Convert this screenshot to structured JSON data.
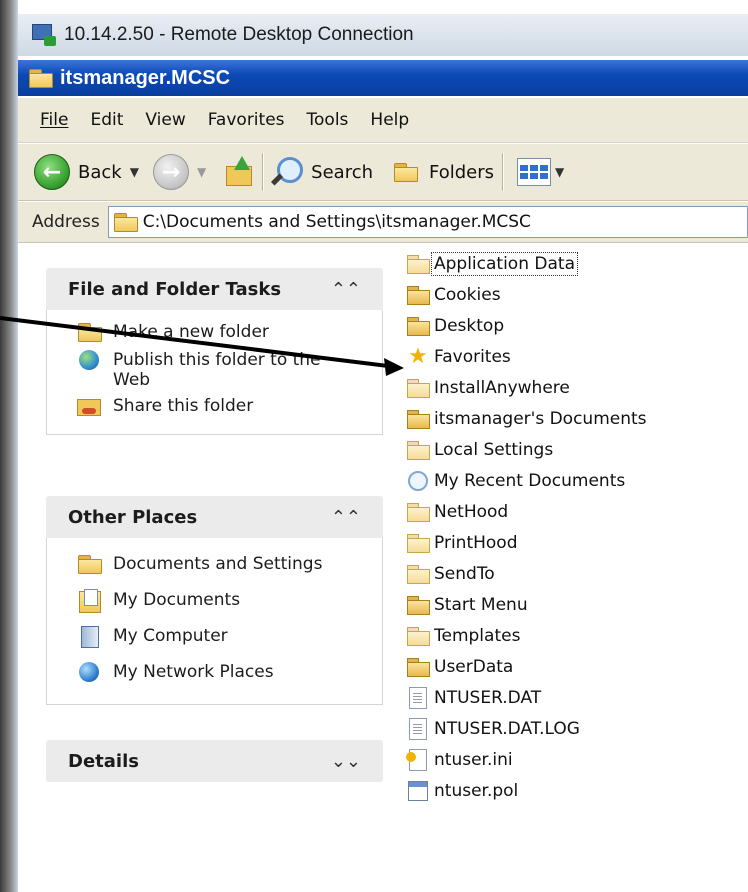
{
  "rdp_window": {
    "title": "10.14.2.50 - Remote Desktop Connection"
  },
  "explorer": {
    "title": "itsmanager.MCSC"
  },
  "menu": {
    "file": "File",
    "edit": "Edit",
    "view": "View",
    "favorites": "Favorites",
    "tools": "Tools",
    "help": "Help"
  },
  "toolbar": {
    "back": "Back",
    "search": "Search",
    "folders": "Folders"
  },
  "address": {
    "label": "Address",
    "path": "C:\\Documents and Settings\\itsmanager.MCSC"
  },
  "file_folder_tasks": {
    "header": "File and Folder Tasks",
    "chevron": "≈",
    "items": [
      {
        "label": "Make a new folder",
        "icon": "new-folder-icon"
      },
      {
        "label": "Publish this folder to the Web",
        "icon": "publish-web-icon"
      },
      {
        "label": "Share this folder",
        "icon": "share-folder-icon"
      }
    ]
  },
  "other_places": {
    "header": "Other Places",
    "chevron": "≈",
    "items": [
      {
        "label": "Documents and Settings",
        "icon": "folder-icon"
      },
      {
        "label": "My Documents",
        "icon": "my-documents-icon"
      },
      {
        "label": "My Computer",
        "icon": "my-computer-icon"
      },
      {
        "label": "My Network Places",
        "icon": "my-network-places-icon"
      }
    ]
  },
  "details": {
    "header": "Details",
    "chevron": "¥"
  },
  "files": [
    {
      "name": "Application Data",
      "icon": "folder-icon-pale"
    },
    {
      "name": "Cookies",
      "icon": "folder-icon"
    },
    {
      "name": "Desktop",
      "icon": "folder-icon"
    },
    {
      "name": "Favorites",
      "icon": "star-icon"
    },
    {
      "name": "InstallAnywhere",
      "icon": "folder-icon-pale"
    },
    {
      "name": "itsmanager's Documents",
      "icon": "folder-icon"
    },
    {
      "name": "Local Settings",
      "icon": "folder-icon-pale"
    },
    {
      "name": "My Recent Documents",
      "icon": "recent-documents-icon"
    },
    {
      "name": "NetHood",
      "icon": "folder-icon-pale"
    },
    {
      "name": "PrintHood",
      "icon": "folder-icon-pale"
    },
    {
      "name": "SendTo",
      "icon": "folder-icon-pale"
    },
    {
      "name": "Start Menu",
      "icon": "folder-icon"
    },
    {
      "name": "Templates",
      "icon": "folder-icon-pale"
    },
    {
      "name": "UserData",
      "icon": "folder-icon"
    },
    {
      "name": "NTUSER.DAT",
      "icon": "dat-file-icon"
    },
    {
      "name": "NTUSER.DAT.LOG",
      "icon": "dat-file-icon"
    },
    {
      "name": "ntuser.ini",
      "icon": "ini-file-icon"
    },
    {
      "name": "ntuser.pol",
      "icon": "pol-file-icon"
    }
  ]
}
